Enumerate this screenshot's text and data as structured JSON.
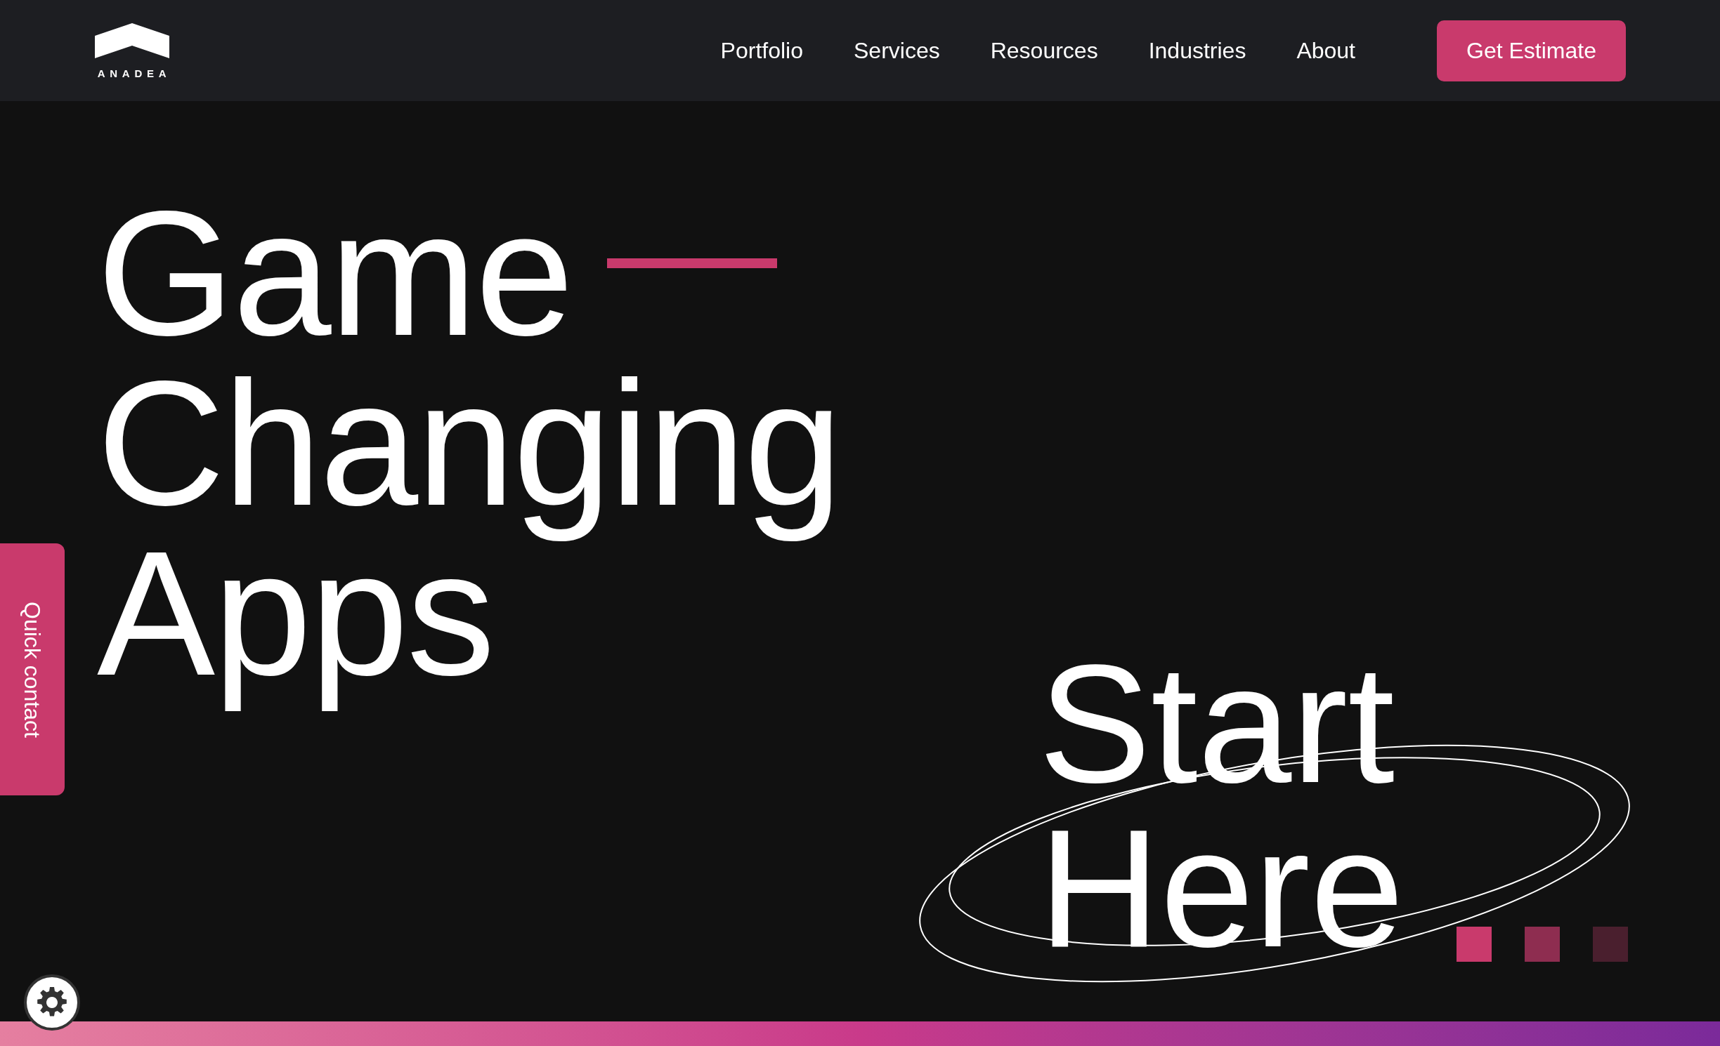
{
  "header": {
    "logo_text": "ANADEA",
    "nav": [
      "Portfolio",
      "Services",
      "Resources",
      "Industries",
      "About"
    ],
    "cta": "Get Estimate"
  },
  "hero": {
    "headline": [
      "Game",
      "Changing",
      "Apps"
    ],
    "tagline": [
      "Start",
      "Here"
    ],
    "dots": [
      {
        "color": "#c93a6c"
      },
      {
        "color": "#8e2d50"
      },
      {
        "color": "#4a1f2e"
      }
    ]
  },
  "quick_contact": "Quick contact"
}
